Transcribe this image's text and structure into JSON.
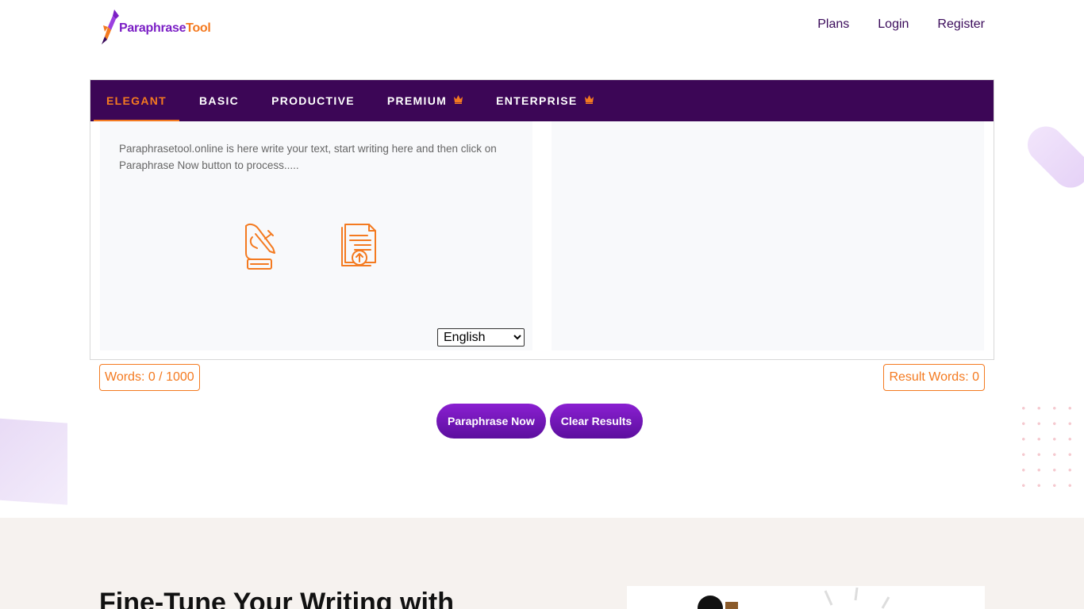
{
  "header": {
    "logo": {
      "part1": "Paraphrase",
      "part2": "Tool"
    },
    "nav": [
      {
        "label": "Plans"
      },
      {
        "label": "Login"
      },
      {
        "label": "Register"
      }
    ]
  },
  "tabs": [
    {
      "label": "ELEGANT",
      "active": true
    },
    {
      "label": "BASIC"
    },
    {
      "label": "PRODUCTIVE"
    },
    {
      "label": "PREMIUM",
      "icon": "crown-icon"
    },
    {
      "label": "ENTERPRISE",
      "icon": "crown-icon"
    }
  ],
  "editor": {
    "placeholder": "Paraphrasetool.online is here write your text, start writing here and then click on Paraphrase Now button to process.....",
    "language": {
      "selected": "English"
    }
  },
  "counts": {
    "words": "Words: 0 / 1000",
    "result_words": "Result Words: 0"
  },
  "actions": {
    "paraphrase": "Paraphrase Now",
    "clear": "Clear Results"
  },
  "lower": {
    "heading": "Fine-Tune Your Writing with"
  },
  "colors": {
    "brand_purple": "#3c0656",
    "accent_orange": "#f47a20",
    "button_purple": "#7a19c0"
  }
}
